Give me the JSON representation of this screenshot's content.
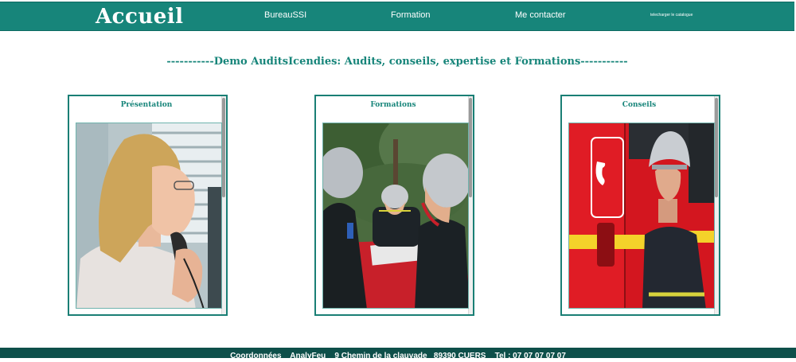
{
  "header": {
    "brand": "Accueil",
    "nav": [
      {
        "label": "BureauSSI"
      },
      {
        "label": "Formation"
      },
      {
        "label": "Me contacter"
      },
      {
        "label": "telecharger le catalogue"
      }
    ]
  },
  "headline": "-----------Demo AuditsIcendies: Audits, conseils, expertise et Formations-----------",
  "cards": [
    {
      "title": "Présentation",
      "image": "woman-on-phone-photo"
    },
    {
      "title": "Formations",
      "image": "firefighters-training-photo"
    },
    {
      "title": "Conseils",
      "image": "firefighter-fire-truck-photo"
    }
  ],
  "footer": {
    "text": "Coordonnées    AnalyFeu    9 Chemin de la clauvade   89390 CUERS    Tel : 07 07 07 07 07"
  },
  "colors": {
    "primary": "#17857a",
    "footer": "#0e4f4a",
    "card_border": "#1a7f75"
  }
}
